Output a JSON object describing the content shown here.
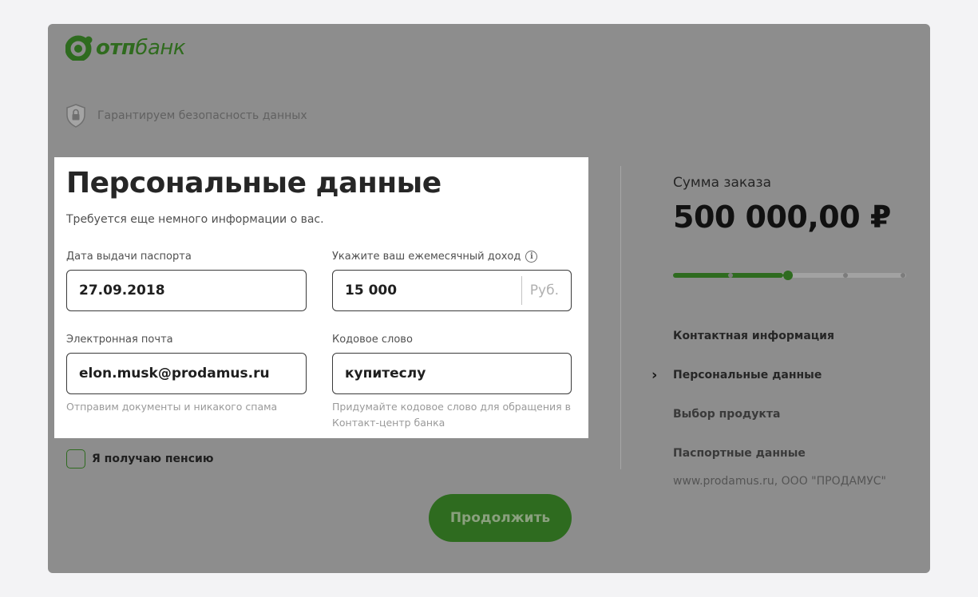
{
  "brand": {
    "logo_text_bold": "отп",
    "logo_text_thin": "банк",
    "color": "#2e6b1f"
  },
  "security": {
    "icon": "shield-lock-icon",
    "text": "Гарантируем безопасность данных"
  },
  "form": {
    "title": "Персональные данные",
    "subtitle": "Требуется еще немного информации о вас.",
    "passport_date": {
      "label": "Дата выдачи паспорта",
      "value": "27.09.2018"
    },
    "income": {
      "label": "Укажите ваш ежемесячный доход",
      "info_icon": "i",
      "value": "15 000",
      "unit": "Руб."
    },
    "email": {
      "label": "Электронная почта",
      "value": "elon.musk@prodamus.ru",
      "hint": "Отправим документы и никакого спама"
    },
    "code_word": {
      "label": "Кодовое слово",
      "value": "купитеслу",
      "hint_line1": "Придумайте кодовое слово для обращения в",
      "hint_line2": "Контакт-центр банка"
    },
    "pension": {
      "label": "Я получаю пенсию",
      "checked": false
    },
    "continue_label": "Продолжить"
  },
  "summary": {
    "label": "Сумма заказа",
    "amount": "500 000,00 ₽",
    "progress": {
      "steps_total": 5,
      "current_step": 2
    },
    "steps": [
      {
        "label": "Контактная информация",
        "current": false
      },
      {
        "label": "Персональные данные",
        "current": true
      },
      {
        "label": "Выбор продукта",
        "current": false
      },
      {
        "label": "Паспортные данные",
        "current": false
      }
    ],
    "footer": "www.prodamus.ru, ООО \"ПРОДАМУС\""
  }
}
